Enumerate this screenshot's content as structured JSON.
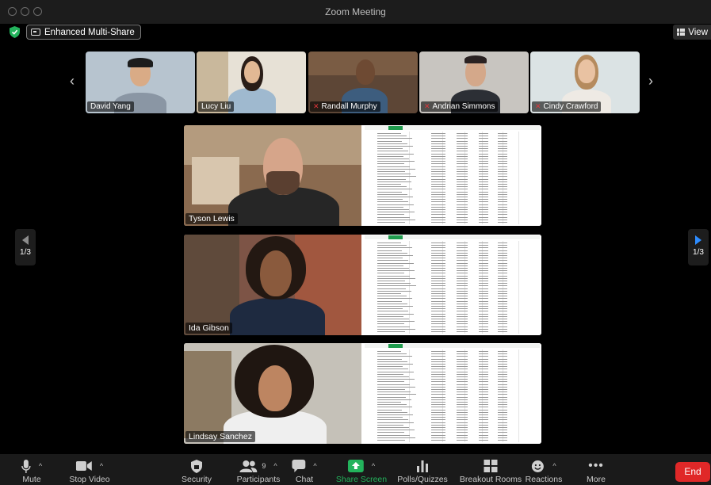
{
  "window": {
    "title": "Zoom Meeting"
  },
  "header": {
    "enhanced_label": "Enhanced Multi-Share",
    "view_label": "View"
  },
  "thumbnails": [
    {
      "name": "David Yang",
      "muted": false
    },
    {
      "name": "Lucy Liu",
      "muted": false
    },
    {
      "name": "Randall Murphy",
      "muted": true
    },
    {
      "name": "Andrian Simmons",
      "muted": true
    },
    {
      "name": "Cindy Crawford",
      "muted": true
    }
  ],
  "tiles": [
    {
      "name": "Tyson Lewis"
    },
    {
      "name": "Ida Gibson"
    },
    {
      "name": "Lindsay Sanchez"
    }
  ],
  "pager": {
    "left_label": "1/3",
    "right_label": "1/3"
  },
  "toolbar": {
    "mute": "Mute",
    "stop_video": "Stop Video",
    "security": "Security",
    "participants": "Participants",
    "participants_count": "9",
    "chat": "Chat",
    "share_screen": "Share Screen",
    "polls": "Polls/Quizzes",
    "breakout": "Breakout Rooms",
    "reactions": "Reactions",
    "more": "More",
    "end": "End"
  },
  "colors": {
    "share_green": "#23b35c",
    "end_red": "#e02828",
    "mic_off_red": "#e0363b",
    "pager_blue": "#2d8cff"
  }
}
